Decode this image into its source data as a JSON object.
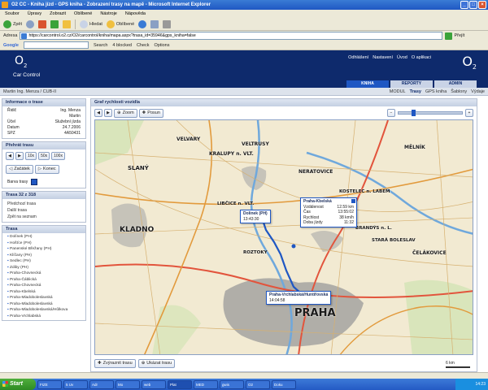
{
  "window": {
    "title": "O2 CC - Kniha jízd - GPS kniha - Zobrazení trasy na mapě - Microsoft Internet Explorer"
  },
  "menu": [
    "Soubor",
    "Úpravy",
    "Zobrazit",
    "Oblíbené",
    "Nástroje",
    "Nápověda"
  ],
  "toolbar": {
    "back": "Zpět",
    "search": "Hledat",
    "favorites": "Oblíbené"
  },
  "address": {
    "label": "Adresa",
    "url": "https://carcontrol.o2.cz/O2/carcontrol/kniha/mapa.aspx?trasa_id=35946&gps_kniha=false",
    "go": "Přejít"
  },
  "googlebar": {
    "logo": "Google",
    "search": "Search",
    "blocked": "4 blocked",
    "check": "Check",
    "options": "Options"
  },
  "header": {
    "brand": "O",
    "brand_sub": "2",
    "product": "Car Control",
    "links": [
      "Odhlášení",
      "Nastavení",
      "Úvod",
      "O aplikaci"
    ],
    "tabs": [
      "KNIHA",
      "REPORTY",
      "ADMIN"
    ]
  },
  "subheader": {
    "user": "Martin Ing. Menza / CUB-II",
    "nav": [
      "MODUL",
      "Trasy",
      "GPS kniha",
      "Šablony",
      "Výdaje"
    ]
  },
  "info": {
    "title": "Informace o trase",
    "rows": [
      {
        "k": "Řidič",
        "v": "Ing. Menza Martin"
      },
      {
        "k": "Účel",
        "v": "Služební jízda"
      },
      {
        "k": "Datum",
        "v": "24.7.2006"
      },
      {
        "k": "SPZ",
        "v": "4A50431"
      }
    ]
  },
  "playback": {
    "title": "Přehrát trasu",
    "speeds": [
      "10x",
      "50x",
      "100x"
    ],
    "start": "Začátek",
    "end": "Konec",
    "color_label": "Barva trasy"
  },
  "nav": {
    "title": "Trasa 32 z 318",
    "prev": "Předchozí trasa",
    "next": "Další trasa",
    "back": "Zpět na seznam"
  },
  "route": {
    "title": "Trasa",
    "items": [
      "Dolínek (PH)",
      "Hošťce (PH)",
      "Panenské Břežany (PH)",
      "Klíčany (PH)",
      "Sedlec (PH)",
      "Zdiby (PH)",
      "Praha-Chovnecká",
      "Praha-Čáblická",
      "Praha-Chovnecká",
      "Praha-Kbelská",
      "Praha-Mladoboleslavská",
      "Praha-Mladoboleslavská",
      "Praha-Mladoboleslavská/Hůlkova",
      "Praha-Vrchlabská"
    ]
  },
  "map": {
    "title": "Graf rychlosti vozidla",
    "zoom": "Zoom",
    "pan": "Posun",
    "show_route": "Zvýraznit trasu",
    "show_map": "Ukázat trasu",
    "scale": "6 km"
  },
  "places": [
    "VELVARY",
    "KRALUPY n. VLT.",
    "VELTRUSY",
    "NERATOVICE",
    "KOSTELEC n. LABEM",
    "SLANÝ",
    "LIBČICE n. VLT.",
    "MĚLNÍK",
    "BRANDÝS n. L.",
    "STARÁ BOLESLAV",
    "KLADNO",
    "ČELÁKOVICE",
    "PRAHA",
    "ROZTOKY"
  ],
  "callouts": [
    {
      "title": "Dolínek (PH)",
      "time": "13:43:30"
    },
    {
      "title": "Praha-Kbelská",
      "rows": [
        {
          "k": "Vzdálenost",
          "v": "12.59 km"
        },
        {
          "k": "Čas",
          "v": "13:55:02"
        },
        {
          "k": "Rychlost",
          "v": "38 km/h"
        },
        {
          "k": "Doba jízdy",
          "v": "11:32"
        }
      ]
    },
    {
      "title": "Praha-Vrchlabská/Huntířovská",
      "time": "14:04:58"
    }
  ],
  "taskbar": {
    "start": "Start",
    "tasks": [
      "FIZE",
      "5 Uv",
      "Adr",
      "Mo",
      "web",
      "Plat",
      "MED",
      "gwis",
      "O2",
      "Doku"
    ],
    "clock": "14:23"
  },
  "colors": {
    "brand": "#0e2a6c",
    "route": "#1f57c3",
    "map_bg": "#f2ead2"
  }
}
